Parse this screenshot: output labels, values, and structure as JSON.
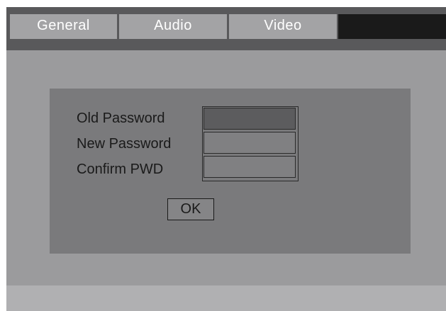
{
  "tabs": [
    {
      "label": "General"
    },
    {
      "label": "Audio"
    },
    {
      "label": "Video"
    },
    {
      "label": ""
    }
  ],
  "dialog": {
    "fields": [
      {
        "label": "Old Password",
        "value": ""
      },
      {
        "label": "New Password",
        "value": ""
      },
      {
        "label": "Confirm PWD",
        "value": ""
      }
    ],
    "ok_label": "OK"
  },
  "colors": {
    "tab_bar": "#59595b",
    "tab": "#a3a3a5",
    "tab_selected": "#1a1a1a",
    "content_bg": "#9b9b9d",
    "dialog_bg": "#7a7a7c",
    "field_active": "#5c5c5e",
    "bottom_bar": "#b0b0b2"
  }
}
